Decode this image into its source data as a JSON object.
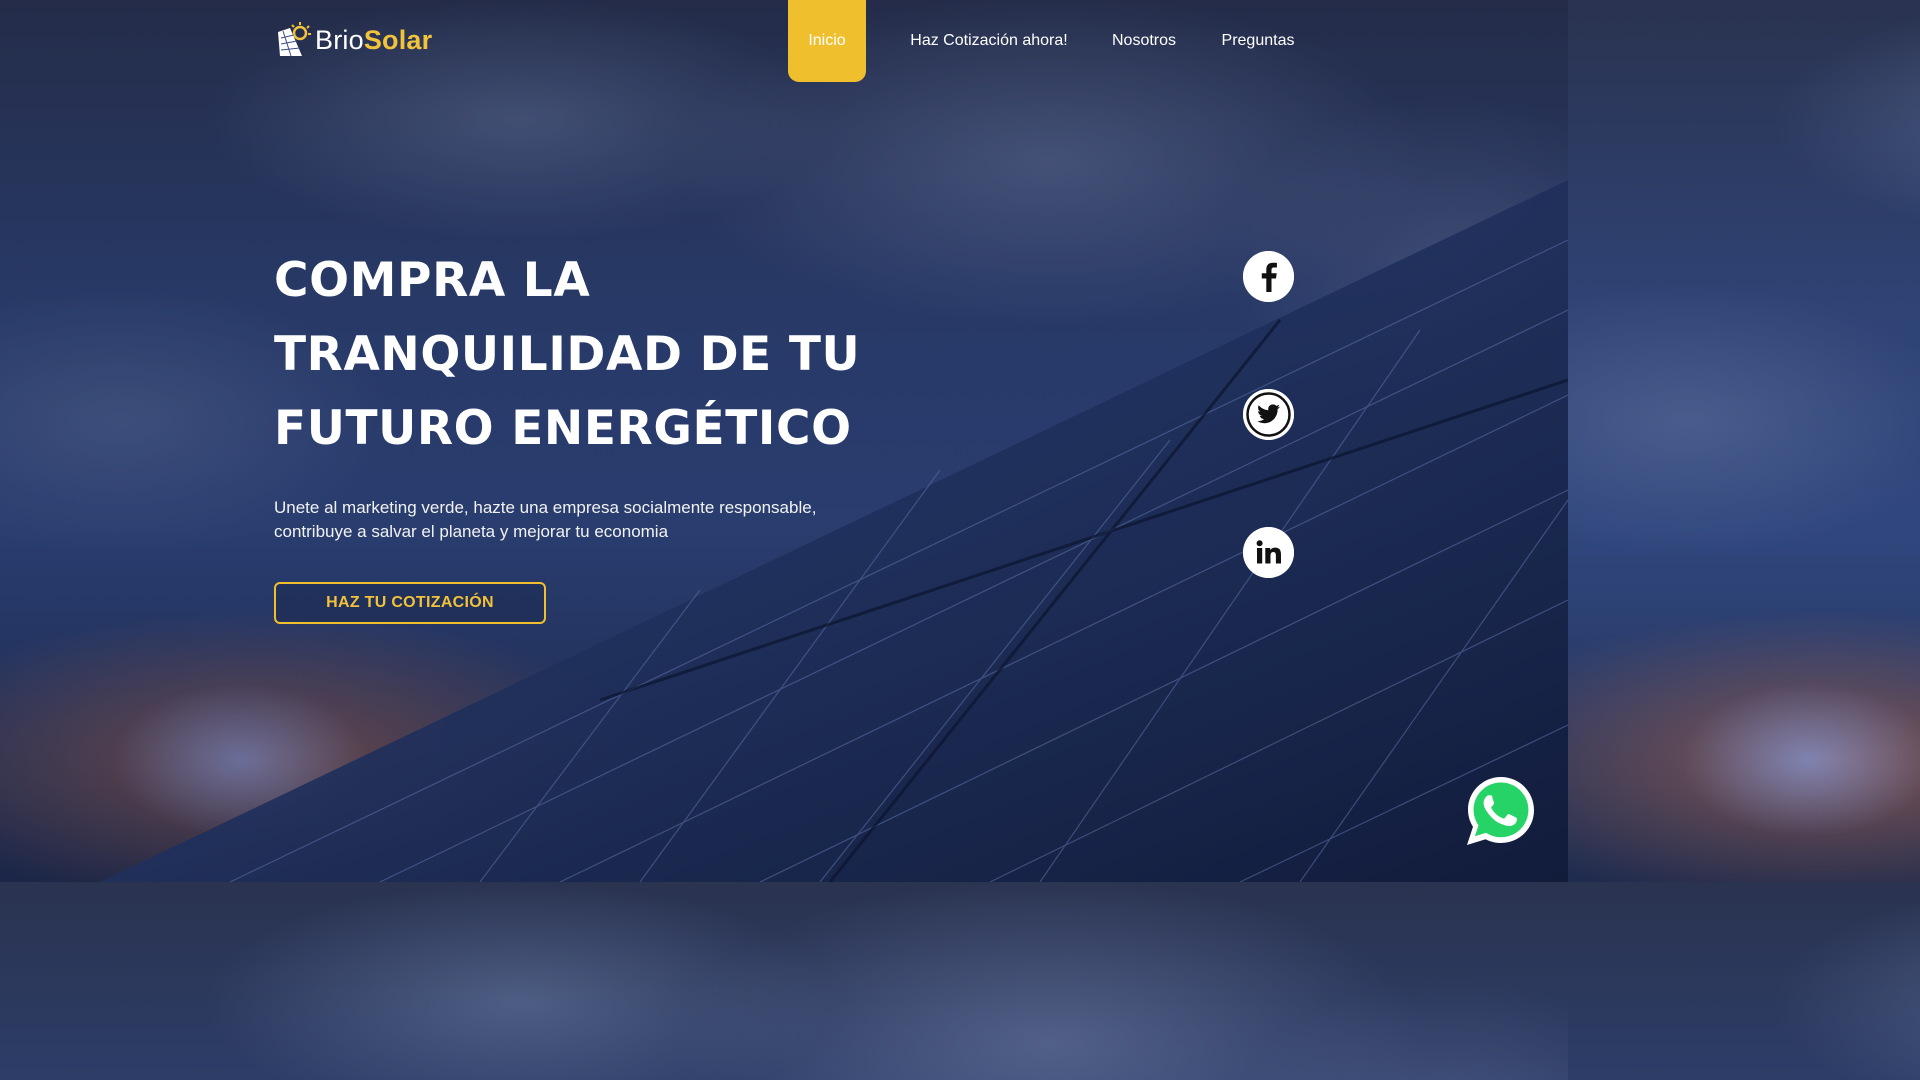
{
  "brand": {
    "name_part1": "Brio",
    "name_part2": "Solar"
  },
  "nav": {
    "items": [
      {
        "label": "Inicio",
        "active": true
      },
      {
        "label": "Haz Cotización ahora!"
      },
      {
        "label": "Nosotros"
      },
      {
        "label": "Preguntas"
      }
    ]
  },
  "hero": {
    "title_lines": [
      "COMPRA LA",
      "TRANQUILIDAD DE TU",
      "FUTURO ENERGÉTICO"
    ],
    "subtitle_lines": [
      "Unete al marketing verde, hazte una empresa socialmente responsable,",
      "contribuye a salvar el planeta y mejorar tu economia"
    ],
    "cta_label": "HAZ TU COTIZACIÓN"
  },
  "social": {
    "icons": [
      "facebook-icon",
      "twitter-icon",
      "linkedin-icon"
    ]
  },
  "floating": {
    "icon": "whatsapp-icon"
  },
  "colors": {
    "accent": "#f0bf2e",
    "text_light": "#ffffff",
    "sky_dark": "#1f2b4e",
    "sky_mid": "#30477e",
    "whatsapp_green": "#25d366"
  }
}
